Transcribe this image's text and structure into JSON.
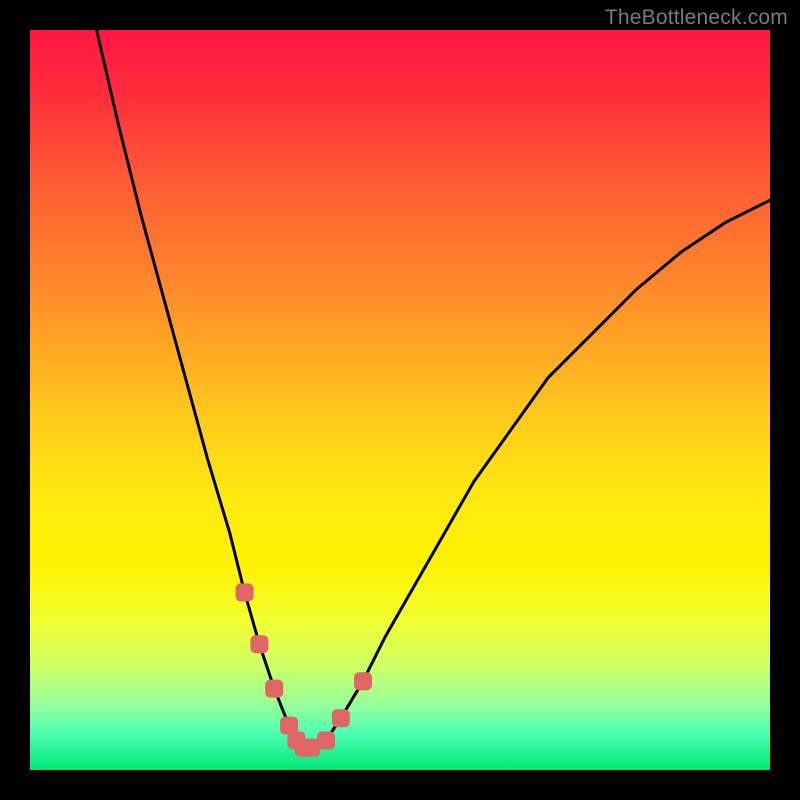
{
  "watermark": "TheBottleneck.com",
  "chart_data": {
    "type": "line",
    "title": "",
    "xlabel": "",
    "ylabel": "",
    "xlim": [
      0,
      100
    ],
    "ylim": [
      0,
      100
    ],
    "grid": false,
    "legend": false,
    "series": [
      {
        "name": "bottleneck-curve",
        "x": [
          9,
          12,
          15,
          18,
          21,
          24,
          27,
          29,
          31,
          33,
          35,
          36,
          37,
          38,
          40,
          42,
          45,
          48,
          52,
          56,
          60,
          65,
          70,
          76,
          82,
          88,
          94,
          100
        ],
        "y": [
          100,
          87,
          75,
          64,
          53,
          42,
          32,
          24,
          17,
          11,
          6,
          4,
          3,
          3,
          4,
          7,
          12,
          18,
          25,
          32,
          39,
          46,
          53,
          59,
          65,
          70,
          74,
          77
        ]
      }
    ],
    "highlight_segment": {
      "name": "near-minimum-markers",
      "description": "salmon-colored dotted markers near curve minimum",
      "x": [
        29,
        31,
        33,
        35,
        36,
        37,
        38,
        40,
        42,
        45
      ],
      "y": [
        24,
        17,
        11,
        6,
        4,
        3,
        3,
        4,
        7,
        12
      ]
    },
    "gradient_stops": [
      {
        "offset": 0.0,
        "color": "#ff1744"
      },
      {
        "offset": 0.08,
        "color": "#ff2a3c"
      },
      {
        "offset": 0.2,
        "color": "#ff5a36"
      },
      {
        "offset": 0.35,
        "color": "#ff8a2b"
      },
      {
        "offset": 0.5,
        "color": "#ffc21f"
      },
      {
        "offset": 0.62,
        "color": "#ffe713"
      },
      {
        "offset": 0.72,
        "color": "#fff200"
      },
      {
        "offset": 0.8,
        "color": "#f2ff33"
      },
      {
        "offset": 0.86,
        "color": "#ccff66"
      },
      {
        "offset": 0.91,
        "color": "#99ff99"
      },
      {
        "offset": 0.95,
        "color": "#4dffb3"
      },
      {
        "offset": 1.0,
        "color": "#00e676"
      }
    ]
  }
}
